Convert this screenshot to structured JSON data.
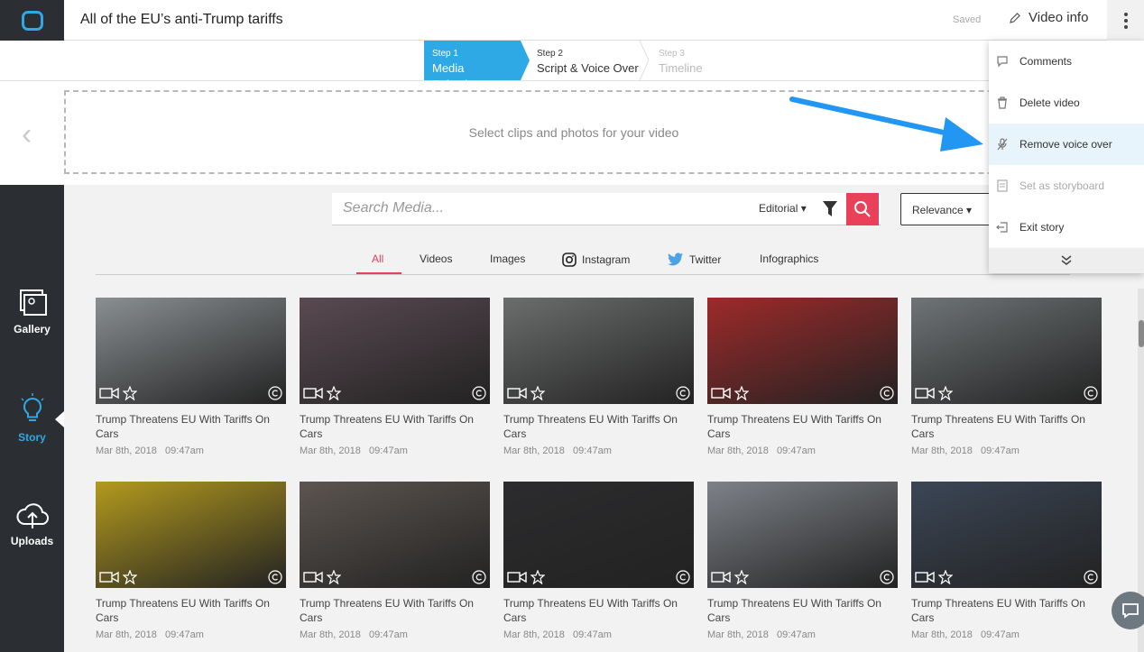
{
  "app": {
    "title": "All of the EU’s anti-Trump tariffs",
    "saved_label": "Saved",
    "video_info_label": "Video info"
  },
  "steps": [
    {
      "step": "Step 1",
      "label": "Media Selection",
      "state": "active"
    },
    {
      "step": "Step 2",
      "label": "Script & Voice Over",
      "state": "normal"
    },
    {
      "step": "Step 3",
      "label": "Timeline",
      "state": "disabled"
    }
  ],
  "dropzone": {
    "text": "Select clips and photos for your video"
  },
  "sidebar": {
    "items": [
      {
        "label": "Gallery",
        "icon": "gallery-icon"
      },
      {
        "label": "Story",
        "icon": "lightbulb-icon"
      },
      {
        "label": "Uploads",
        "icon": "cloud-upload-icon"
      }
    ]
  },
  "search": {
    "placeholder": "Search Media...",
    "source_label": "Editorial",
    "sort_label": "Relevance"
  },
  "tabs": [
    "All",
    "Videos",
    "Images",
    "Instagram",
    "Twitter",
    "Infographics"
  ],
  "menu": {
    "items": [
      {
        "label": "Comments",
        "icon": "comment-icon"
      },
      {
        "label": "Delete video",
        "icon": "trash-icon"
      },
      {
        "label": "Remove voice over",
        "icon": "mic-off-icon"
      },
      {
        "label": "Set as storyboard",
        "icon": "storyboard-icon"
      },
      {
        "label": "Exit story",
        "icon": "exit-icon"
      }
    ]
  },
  "media": [
    {
      "title": "Trump Threatens EU With Tariffs On Cars",
      "date": "Mar 8th, 2018",
      "time": "09:47am",
      "color": "#8a8f92"
    },
    {
      "title": "Trump Threatens EU With Tariffs On Cars",
      "date": "Mar 8th, 2018",
      "time": "09:47am",
      "color": "#5a4a52"
    },
    {
      "title": "Trump Threatens EU With Tariffs On Cars",
      "date": "Mar 8th, 2018",
      "time": "09:47am",
      "color": "#6b6e6c"
    },
    {
      "title": "Trump Threatens EU With Tariffs On Cars",
      "date": "Mar 8th, 2018",
      "time": "09:47am",
      "color": "#9e2a2a"
    },
    {
      "title": "Trump Threatens EU With Tariffs On Cars",
      "date": "Mar 8th, 2018",
      "time": "09:47am",
      "color": "#6f7476"
    },
    {
      "title": "Trump Threatens EU With Tariffs On Cars",
      "date": "Mar 8th, 2018",
      "time": "09:47am",
      "color": "#b39a1e"
    },
    {
      "title": "Trump Threatens EU With Tariffs On Cars",
      "date": "Mar 8th, 2018",
      "time": "09:47am",
      "color": "#5c5550"
    },
    {
      "title": "Trump Threatens EU With Tariffs On Cars",
      "date": "Mar 8th, 2018",
      "time": "09:47am",
      "color": "#2c2c2e"
    },
    {
      "title": "Trump Threatens EU With Tariffs On Cars",
      "date": "Mar 8th, 2018",
      "time": "09:47am",
      "color": "#7e8288"
    },
    {
      "title": "Trump Threatens EU With Tariffs On Cars",
      "date": "Mar 8th, 2018",
      "time": "09:47am",
      "color": "#3b4656"
    }
  ],
  "colors": {
    "accent": "#2fa8e6",
    "danger": "#e9415a",
    "sidebar": "#2b2f33"
  }
}
